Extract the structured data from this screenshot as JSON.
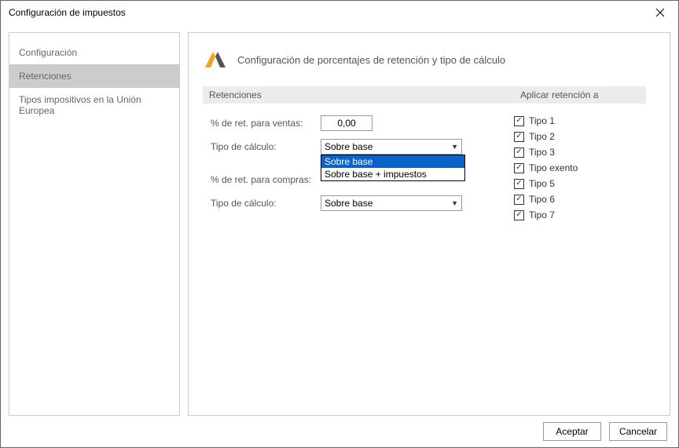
{
  "window": {
    "title": "Configuración de impuestos"
  },
  "sidebar": {
    "items": [
      {
        "label": "Configuración",
        "selected": false
      },
      {
        "label": "Retenciones",
        "selected": true
      },
      {
        "label": "Tipos impositivos en la Unión Europea",
        "selected": false
      }
    ]
  },
  "main": {
    "header": "Configuración de porcentajes de retención y tipo de cálculo",
    "section_left": "Retenciones",
    "section_right": "Aplicar retención a",
    "labels": {
      "ret_ventas": "% de ret. para ventas:",
      "calc_ventas": "Tipo de cálculo:",
      "ret_compras": "% de ret. para compras:",
      "calc_compras": "Tipo de cálculo:"
    },
    "values": {
      "ret_ventas": "0,00",
      "calc_ventas": "Sobre base",
      "calc_compras": "Sobre base"
    },
    "dropdown_open": {
      "options": [
        "Sobre base",
        "Sobre base + impuestos"
      ],
      "selected_index": 0
    },
    "apply_to": [
      {
        "label": "Tipo 1",
        "checked": true
      },
      {
        "label": "Tipo 2",
        "checked": true
      },
      {
        "label": "Tipo 3",
        "checked": true
      },
      {
        "label": "Tipo exento",
        "checked": true
      },
      {
        "label": "Tipo 5",
        "checked": true
      },
      {
        "label": "Tipo 6",
        "checked": true
      },
      {
        "label": "Tipo 7",
        "checked": true
      }
    ]
  },
  "footer": {
    "ok": "Aceptar",
    "cancel": "Cancelar"
  }
}
